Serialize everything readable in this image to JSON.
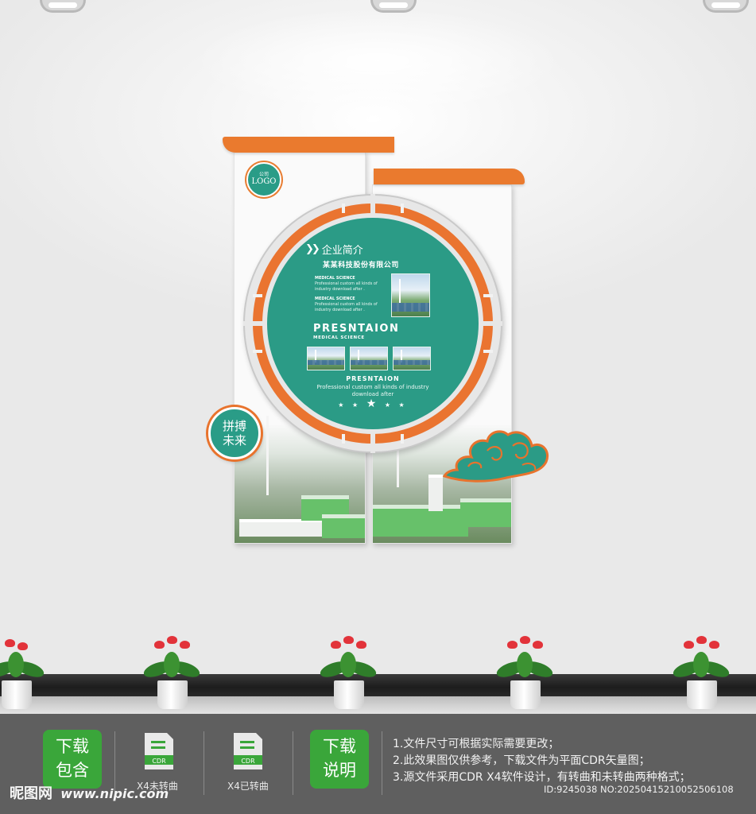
{
  "logo": {
    "top": "公司",
    "main": "LOGO"
  },
  "circle": {
    "title": "企业简介",
    "company": "某某科技股份有限公司",
    "blurb1_head": "MEDICAL SCIENCE",
    "blurb1_text": "Professional custom all kinds of industry download after .",
    "blurb2_head": "MEDICAL SCIENCE",
    "blurb2_text": "Professional custom all kinds of industry download after .",
    "heading": "PRESNTAION",
    "heading_sub": "MEDICAL SCIENCE",
    "mid_heading": "PRESNTAION",
    "mid_text": "Professional custom all kinds of industry download after",
    "stars": "★ ★ ★ ★ ★"
  },
  "slogan": {
    "line1": "拼搏",
    "line2": "未来"
  },
  "footer": {
    "package_label": "下载\n包含",
    "package_line1": "下载",
    "package_line2": "包含",
    "file1_icon_text": "CDR",
    "file1_label": "X4未转曲",
    "file2_icon_text": "CDR",
    "file2_label": "X4已转曲",
    "info_line1": "下载",
    "info_line2": "说明",
    "notes": [
      "1.文件尺寸可根据实际需要更改；",
      "2.此效果图仅供参考，下载文件为平面CDR矢量图；",
      "3.源文件采用CDR X4软件设计，有转曲和未转曲两种格式；"
    ],
    "watermark_site": "昵图网",
    "watermark_url": "www.nipic.com",
    "id_text": "ID:9245038 NO:20250415210052506108"
  },
  "colors": {
    "teal": "#2b9b86",
    "orange": "#ea7430",
    "green_button": "#3aa63a",
    "footer_bg": "#5f5f5f"
  }
}
